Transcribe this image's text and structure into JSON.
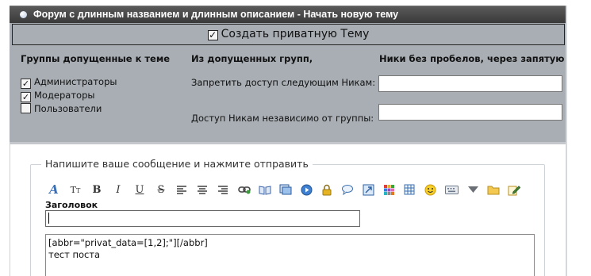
{
  "header": {
    "title": "Форум с длинным названием и длинным описанием - Начать новую тему"
  },
  "private_topic": {
    "label": "Создать приватную Тему",
    "checked": true
  },
  "columns": {
    "groups_heading": "Группы допущенные к теме",
    "from_groups_heading": "Из допущенных групп,",
    "nicks_heading": "Ники без пробелов, через запятую"
  },
  "groups": [
    {
      "label": "Администраторы",
      "checked": true
    },
    {
      "label": "Модераторы",
      "checked": true
    },
    {
      "label": "Пользователи",
      "checked": false
    }
  ],
  "deny_nicks": {
    "label": "Запретить доступ следующим Никам:",
    "value": ""
  },
  "allow_nicks": {
    "label": "Доступ Никам независимо от группы:",
    "value": ""
  },
  "compose": {
    "legend": "Напишите ваше сообщение и нажмите отправить",
    "subject_label": "Заголовок",
    "subject_value": "",
    "message_line1": "[abbr=\"privat_data=[1,2];\"][/abbr]",
    "message_line2": "тест поста"
  },
  "toolbar_icons": [
    "font-face-icon",
    "font-size-icon",
    "bold-icon",
    "italic-icon",
    "underline-icon",
    "strikethrough-icon",
    "align-left-icon",
    "align-center-icon",
    "align-right-icon",
    "link-icon",
    "book-icon",
    "image-icon",
    "video-icon",
    "lock-icon",
    "speech-bubble-icon",
    "resize-icon",
    "color-palette-icon",
    "table-icon",
    "smiley-icon",
    "keyboard-icon",
    "more-dropdown-icon",
    "folder-icon",
    "edit-note-icon"
  ]
}
